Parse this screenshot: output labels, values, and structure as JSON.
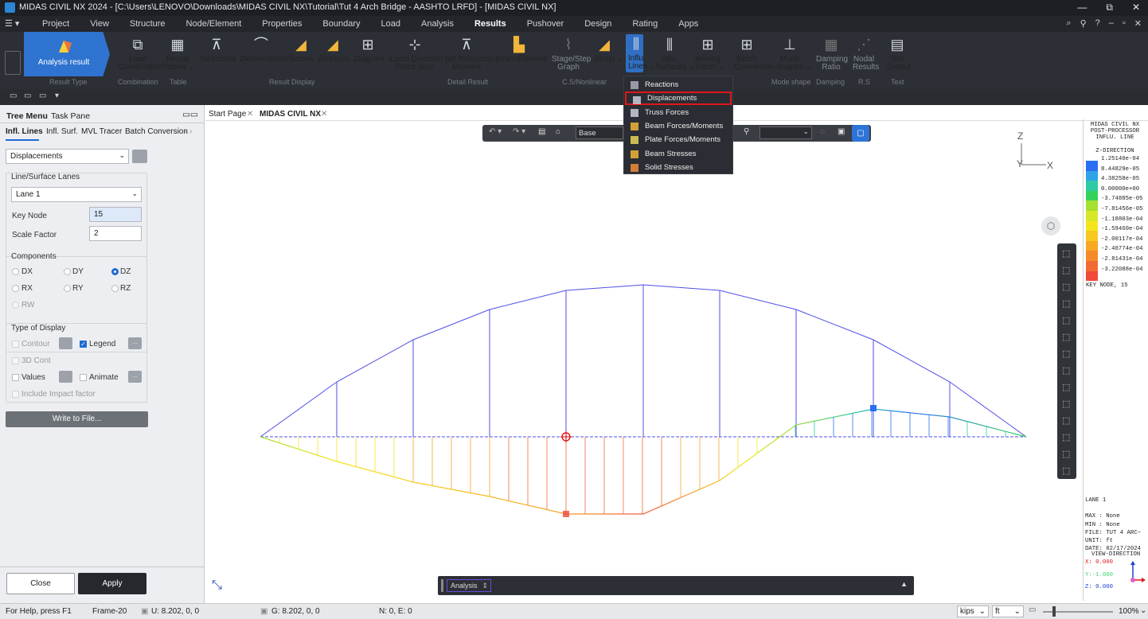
{
  "window": {
    "title": "MIDAS CIVIL NX 2024 - [C:\\Users\\LENOVO\\Downloads\\MIDAS CIVIL NX\\Tutorial\\Tut 4 Arch Bridge - AASHTO LRFD] - [MIDAS CIVIL NX]",
    "controls": [
      "—",
      "⧉",
      "✕"
    ]
  },
  "menu": {
    "items": [
      "Project",
      "View",
      "Structure",
      "Node/Element",
      "Properties",
      "Boundary",
      "Load",
      "Analysis",
      "Results",
      "Pushover",
      "Design",
      "Rating",
      "Apps"
    ],
    "active": "Results",
    "right_icons": [
      "search-icon",
      "help-icon",
      "info-icon",
      "minimize-icon",
      "restore-icon",
      "close-icon"
    ]
  },
  "ribbon": {
    "analysis_result": "Analysis result",
    "buttons": [
      {
        "l1": "Load",
        "l2": "Combination"
      },
      {
        "l1": "Result",
        "l2": "Tables ⌄"
      },
      {
        "l1": "Reactions ⌄",
        "l2": ""
      },
      {
        "l1": "Deformations ⌄",
        "l2": ""
      },
      {
        "l1": "Forces ⌄",
        "l2": ""
      },
      {
        "l1": "Stresses ⌄",
        "l2": ""
      },
      {
        "l1": "Diagram ⌄",
        "l2": ""
      },
      {
        "l1": "Local Direction",
        "l2": "Force Sum"
      },
      {
        "l1": "Set Reduction",
        "l2": "Moment"
      },
      {
        "l1": "Beam/Element ⌄",
        "l2": ""
      },
      {
        "l1": "Stage/Step",
        "l2": "Graph"
      },
      {
        "l1": "Strain ⌄",
        "l2": ""
      },
      {
        "l1": "Influ.",
        "l2": "Lines ⌄"
      },
      {
        "l1": "Influ.",
        "l2": "Surfaces ⌄"
      },
      {
        "l1": "Moving",
        "l2": "Tracer ⌄"
      },
      {
        "l1": "Batch",
        "l2": "Conversion"
      },
      {
        "l1": "Mode",
        "l2": "Shapes ⌄"
      },
      {
        "l1": "Damping",
        "l2": "Ratio"
      },
      {
        "l1": "Nodal",
        "l2": "Results"
      },
      {
        "l1": "Text",
        "l2": "Output"
      }
    ],
    "groups": [
      "Result Type",
      "Combination",
      "Table",
      "Result Display",
      "Detail Result",
      "C.S/Nonlinear",
      "Mode shape",
      "Damping",
      "R.S",
      "Text"
    ]
  },
  "dropdown": {
    "items": [
      "Reactions",
      "Displacements",
      "Truss Forces",
      "Beam Forces/Moments",
      "Plate Forces/Moments",
      "Beam Stresses",
      "Solid Stresses"
    ],
    "selected": "Displacements",
    "highlight_color": "#e0161b"
  },
  "left_panel": {
    "tabs": [
      "Tree Menu",
      "Task Pane"
    ],
    "subtabs": [
      "Infl. Lines",
      "Infl. Surf.",
      "MVL Tracer",
      "Batch Conversion"
    ],
    "result_select": "Displacements",
    "lanes_group": "Line/Surface Lanes",
    "lane": "Lane 1",
    "key_node_label": "Key Node",
    "key_node": "15",
    "scale_label": "Scale Factor",
    "scale": "2",
    "components_group": "Components",
    "components": [
      "DX",
      "DY",
      "DZ",
      "RX",
      "RY",
      "RZ",
      "RW"
    ],
    "component_selected": "DZ",
    "display_group": "Type of Display",
    "contour": "Contour",
    "legend": "Legend",
    "cont3d": "3D Cont",
    "values": "Values",
    "animate": "Animate",
    "impact": "Include Impact factor",
    "more": "...",
    "write_btn": "Write to File...",
    "close_btn": "Close",
    "apply_btn": "Apply"
  },
  "viewport": {
    "tabs": [
      "Start Page",
      "MIDAS CIVIL NX"
    ],
    "active_tab": "MIDAS CIVIL NX",
    "view_select": "Base",
    "axis": {
      "z": "Z",
      "x": "X",
      "y": "Y"
    },
    "bottom_bar": "Analysis",
    "bottom_bar_arrow": "⇕",
    "bottom_bar_toggle": "▲"
  },
  "legend": {
    "header": [
      "MIDAS CIVIL NX",
      "POST-PROCESSOR",
      "INFLU. LINE"
    ],
    "direction": "Z-DIRECTION",
    "values": [
      "1.25140e-04",
      "8.44829e-05",
      "4.38258e-05",
      "0.00000e+00",
      "-3.74885e-05",
      "-7.81456e-05",
      "-1.18803e-04",
      "-1.59460e-04",
      "-2.00117e-04",
      "-2.40774e-04",
      "-2.81431e-04",
      "-3.22088e-04"
    ],
    "colors": [
      "#2a6ff2",
      "#2ea3e8",
      "#2ccba5",
      "#35d35c",
      "#a6e030",
      "#d7e72a",
      "#f5e51f",
      "#f7c821",
      "#f6a823",
      "#f48a2a",
      "#f26a33",
      "#ef4a3a"
    ],
    "key_node": "KEY NODE, 15",
    "footer": [
      "LANE 1",
      "",
      "MAX : None",
      "MIN : None",
      "FILE: TUT 4 ARC~",
      "UNIT: ft",
      "DATE: 02/17/2024"
    ],
    "view_dir": "VIEW-DIRECTION",
    "vx": "X: 0.000",
    "vy": "Y:-1.000",
    "vz": "Z: 0.000"
  },
  "status": {
    "help": "For Help, press F1",
    "frame": "Frame-20",
    "u": "U: 8.202, 0, 0",
    "g": "G: 8.202, 0, 0",
    "ne": "N: 0, E: 0",
    "force_unit": "kips",
    "len_unit": "ft",
    "zoom": "100%"
  }
}
